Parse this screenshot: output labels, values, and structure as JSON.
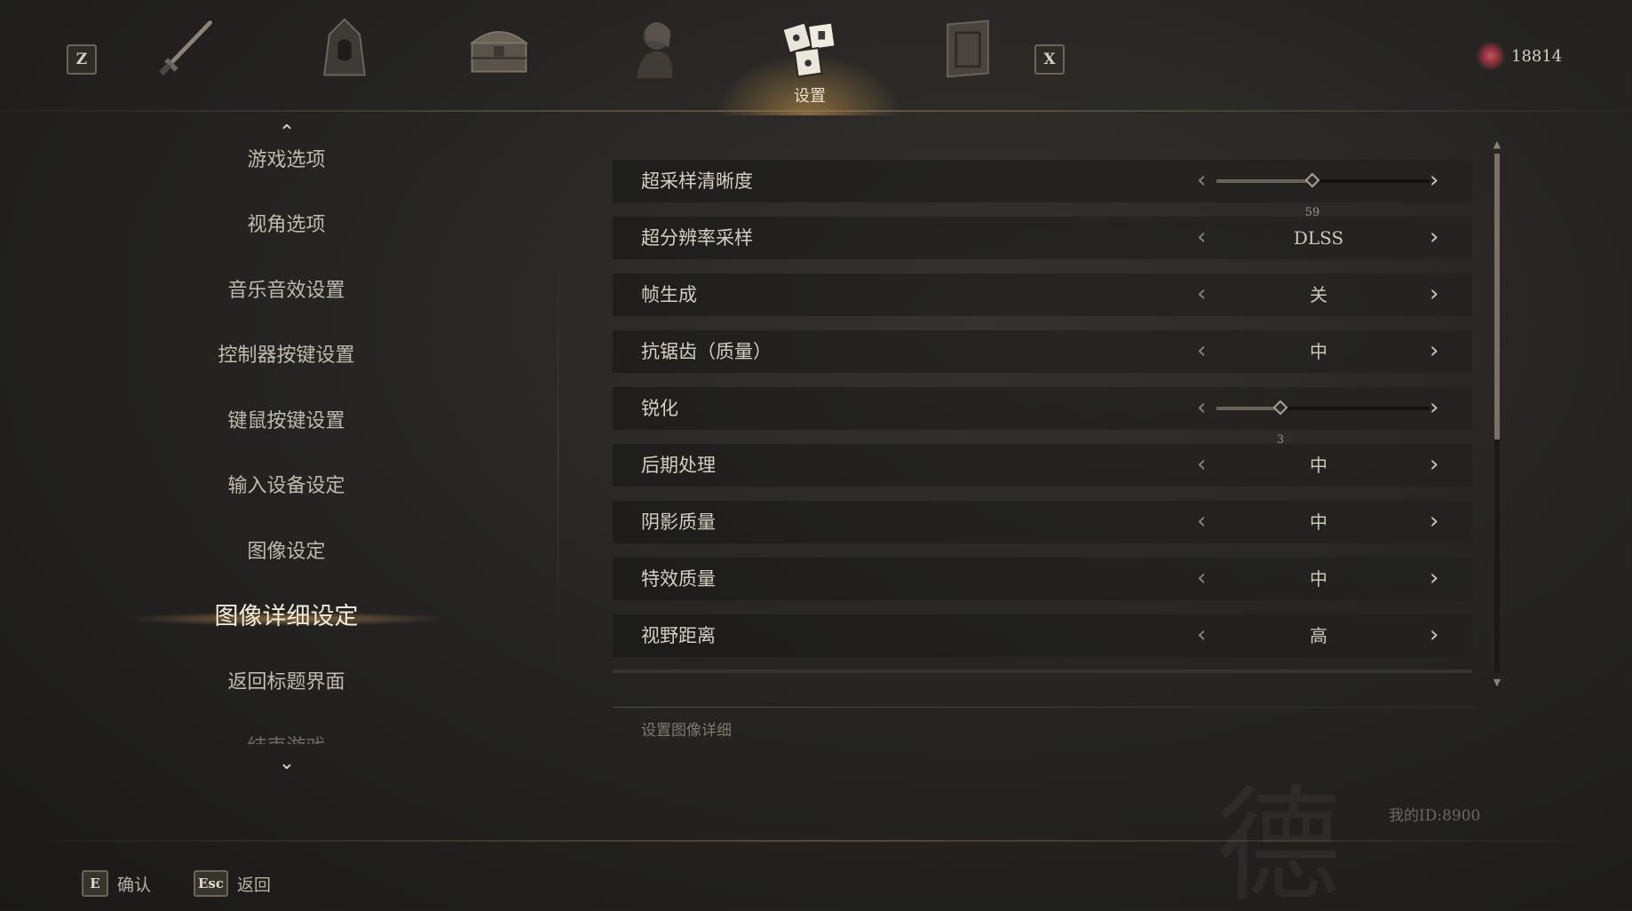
{
  "topbar": {
    "left_key": "Z",
    "right_key": "X",
    "tabs": [
      {
        "icon": "sword-icon"
      },
      {
        "icon": "hood-armor-icon"
      },
      {
        "icon": "treasure-chest-icon"
      },
      {
        "icon": "character-portrait-icon"
      },
      {
        "icon": "mahjong-tiles-icon",
        "label": "设置",
        "active": true
      },
      {
        "icon": "scroll-book-icon"
      }
    ],
    "currency": {
      "icon": "red-gem-icon",
      "value": "18814"
    }
  },
  "menu": {
    "items": [
      {
        "label": "游戏选项"
      },
      {
        "label": "视角选项"
      },
      {
        "label": "音乐音效设置"
      },
      {
        "label": "控制器按键设置"
      },
      {
        "label": "键鼠按键设置"
      },
      {
        "label": "输入设备设定"
      },
      {
        "label": "图像设定"
      },
      {
        "label": "图像详细设定",
        "active": true
      },
      {
        "label": "返回标题界面"
      },
      {
        "label": "结束游戏"
      }
    ]
  },
  "settings": [
    {
      "label": "超采样清晰度",
      "type": "slider",
      "value": "59",
      "fraction": 0.45
    },
    {
      "label": "超分辨率采样",
      "type": "choice",
      "value": "DLSS"
    },
    {
      "label": "帧生成",
      "type": "choice",
      "value": "关"
    },
    {
      "label": "抗锯齿（质量）",
      "type": "choice",
      "value": "中"
    },
    {
      "label": "锐化",
      "type": "slider",
      "value": "3",
      "fraction": 0.3
    },
    {
      "label": "后期处理",
      "type": "choice",
      "value": "中"
    },
    {
      "label": "阴影质量",
      "type": "choice",
      "value": "中"
    },
    {
      "label": "特效质量",
      "type": "choice",
      "value": "中"
    },
    {
      "label": "视野距离",
      "type": "choice",
      "value": "高"
    }
  ],
  "scroll": {
    "fraction_start": 0.0,
    "fraction_visible": 0.55
  },
  "description": "设置图像详细",
  "my_id": "我的ID:8900",
  "hints": [
    {
      "key": "E",
      "label": "确认"
    },
    {
      "key": "Esc",
      "label": "返回"
    }
  ],
  "colors": {
    "accent_glow": "#d7a55a",
    "currency_gem": "#c7525c"
  }
}
